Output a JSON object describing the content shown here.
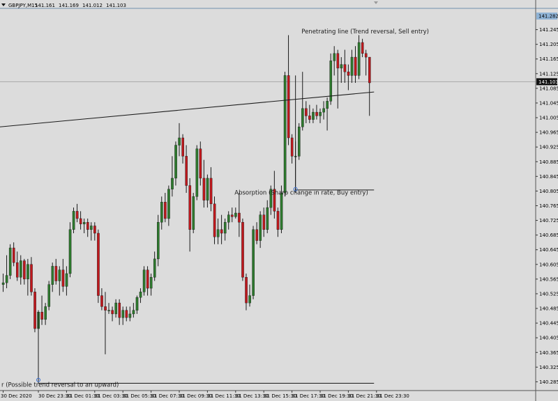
{
  "symbol_header": {
    "symbol": "GBPJPY,M15",
    "ohlc": [
      "141.161",
      "141.169",
      "141.012",
      "141.103"
    ],
    "menu_arrow_icon": "triangle-down-icon"
  },
  "colors": {
    "background": "#dcdcdc",
    "bull": "#2d7a2d",
    "bear": "#c0181d",
    "wick": "#1a1a1a",
    "line": "#1a1a1a",
    "grid_line": "#a8a8a8",
    "current_price_label_bg": "#111111",
    "top_price_label_bg": "#8fb3d6"
  },
  "chart_data": {
    "type": "candlestick",
    "y_axis_ticks": [
      "141.245",
      "141.205",
      "141.165",
      "141.125",
      "141.085",
      "141.045",
      "141.005",
      "140.965",
      "140.925",
      "140.885",
      "140.845",
      "140.805",
      "140.765",
      "140.725",
      "140.685",
      "140.645",
      "140.605",
      "140.565",
      "140.525",
      "140.485",
      "140.445",
      "140.405",
      "140.365",
      "140.325",
      "140.285"
    ],
    "ylim": [
      140.263,
      141.303
    ],
    "x_axis_ticks": [
      "30 Dec 2020",
      "30 Dec 23:30",
      "31 Dec 01:30",
      "31 Dec 03:30",
      "31 Dec 05:30",
      "31 Dec 07:30",
      "31 Dec 09:30",
      "31 Dec 11:30",
      "31 Dec 13:30",
      "31 Dec 15:30",
      "31 Dec 17:30",
      "31 Dec 19:30",
      "31 Dec 21:30",
      "31 Dec 23:30"
    ],
    "x_tick_index": [
      0,
      10,
      18,
      26,
      34,
      42,
      50,
      58,
      66,
      74,
      82,
      90,
      98,
      106
    ],
    "current_price": "141.103",
    "top_price_label": "141.282",
    "candles": [
      [
        140.55,
        140.58,
        140.53,
        140.555
      ],
      [
        140.555,
        140.63,
        140.54,
        140.575
      ],
      [
        140.575,
        140.66,
        140.565,
        140.65
      ],
      [
        140.65,
        140.665,
        140.6,
        140.61
      ],
      [
        140.61,
        140.64,
        140.56,
        140.57
      ],
      [
        140.57,
        140.63,
        140.55,
        140.615
      ],
      [
        140.615,
        140.62,
        140.55,
        140.565
      ],
      [
        140.565,
        140.62,
        140.52,
        140.605
      ],
      [
        140.605,
        140.625,
        140.52,
        140.53
      ],
      [
        140.53,
        140.54,
        140.42,
        140.43
      ],
      [
        140.43,
        140.48,
        140.28,
        140.475
      ],
      [
        140.475,
        140.52,
        140.44,
        140.455
      ],
      [
        140.455,
        140.5,
        140.44,
        140.49
      ],
      [
        140.49,
        140.56,
        140.48,
        140.55
      ],
      [
        140.55,
        140.61,
        140.53,
        140.6
      ],
      [
        140.6,
        140.62,
        140.55,
        140.56
      ],
      [
        140.56,
        140.6,
        140.52,
        140.59
      ],
      [
        140.59,
        140.62,
        140.53,
        140.545
      ],
      [
        140.545,
        140.6,
        140.52,
        140.58
      ],
      [
        140.58,
        140.72,
        140.57,
        140.7
      ],
      [
        140.7,
        140.76,
        140.69,
        140.75
      ],
      [
        140.75,
        140.77,
        140.72,
        140.73
      ],
      [
        140.73,
        140.75,
        140.7,
        140.715
      ],
      [
        140.715,
        140.73,
        140.69,
        140.72
      ],
      [
        140.72,
        140.73,
        140.68,
        140.7
      ],
      [
        140.7,
        140.72,
        140.67,
        140.71
      ],
      [
        140.71,
        140.72,
        140.67,
        140.69
      ],
      [
        140.69,
        140.7,
        140.5,
        140.52
      ],
      [
        140.52,
        140.54,
        140.48,
        140.49
      ],
      [
        140.49,
        140.53,
        140.36,
        140.48
      ],
      [
        140.48,
        140.5,
        140.47,
        140.48
      ],
      [
        140.48,
        140.49,
        140.45,
        140.47
      ],
      [
        140.47,
        140.51,
        140.46,
        140.5
      ],
      [
        140.5,
        140.51,
        140.44,
        140.46
      ],
      [
        140.46,
        140.49,
        140.44,
        140.48
      ],
      [
        140.48,
        140.49,
        140.45,
        140.46
      ],
      [
        140.46,
        140.49,
        140.45,
        140.47
      ],
      [
        140.47,
        140.5,
        140.46,
        140.48
      ],
      [
        140.48,
        140.52,
        140.47,
        140.515
      ],
      [
        140.515,
        140.54,
        140.5,
        140.53
      ],
      [
        140.53,
        140.6,
        140.52,
        140.59
      ],
      [
        140.59,
        140.6,
        140.52,
        140.54
      ],
      [
        140.54,
        140.58,
        140.52,
        140.57
      ],
      [
        140.57,
        140.64,
        140.56,
        140.62
      ],
      [
        140.62,
        140.74,
        140.6,
        140.72
      ],
      [
        140.72,
        140.79,
        140.7,
        140.775
      ],
      [
        140.775,
        140.8,
        140.72,
        140.73
      ],
      [
        140.73,
        140.82,
        140.71,
        140.81
      ],
      [
        140.81,
        140.9,
        140.79,
        140.84
      ],
      [
        140.84,
        140.94,
        140.82,
        140.93
      ],
      [
        140.93,
        140.99,
        140.9,
        140.95
      ],
      [
        140.95,
        140.96,
        140.88,
        140.9
      ],
      [
        140.9,
        140.93,
        140.8,
        140.82
      ],
      [
        140.82,
        140.84,
        140.64,
        140.7
      ],
      [
        140.7,
        140.8,
        140.69,
        140.79
      ],
      [
        140.79,
        140.93,
        140.78,
        140.92
      ],
      [
        140.92,
        140.94,
        140.82,
        140.84
      ],
      [
        140.84,
        140.89,
        140.76,
        140.78
      ],
      [
        140.78,
        140.85,
        140.76,
        140.84
      ],
      [
        140.84,
        140.87,
        140.75,
        140.77
      ],
      [
        140.77,
        140.79,
        140.66,
        140.68
      ],
      [
        140.68,
        140.73,
        140.66,
        140.7
      ],
      [
        140.7,
        140.74,
        140.66,
        140.69
      ],
      [
        140.69,
        140.73,
        140.67,
        140.72
      ],
      [
        140.72,
        140.75,
        140.7,
        140.74
      ],
      [
        140.74,
        140.76,
        140.72,
        140.735
      ],
      [
        140.735,
        140.76,
        140.73,
        140.745
      ],
      [
        140.745,
        140.8,
        140.68,
        140.72
      ],
      [
        140.72,
        140.73,
        140.56,
        140.57
      ],
      [
        140.57,
        140.58,
        140.48,
        140.5
      ],
      [
        140.5,
        140.55,
        140.49,
        140.52
      ],
      [
        140.52,
        140.71,
        140.51,
        140.7
      ],
      [
        140.7,
        140.72,
        140.66,
        140.67
      ],
      [
        140.67,
        140.75,
        140.65,
        140.74
      ],
      [
        140.74,
        140.76,
        140.68,
        140.7
      ],
      [
        140.7,
        140.78,
        140.69,
        140.76
      ],
      [
        140.76,
        140.82,
        140.74,
        140.81
      ],
      [
        140.81,
        140.86,
        140.73,
        140.75
      ],
      [
        140.75,
        140.76,
        140.68,
        140.7
      ],
      [
        140.7,
        140.82,
        140.69,
        140.8
      ],
      [
        140.8,
        141.13,
        140.79,
        141.12
      ],
      [
        141.12,
        141.23,
        140.93,
        140.95
      ],
      [
        140.95,
        140.96,
        140.88,
        140.9
      ],
      [
        140.9,
        140.94,
        140.8,
        140.9
      ],
      [
        140.9,
        140.99,
        140.89,
        140.98
      ],
      [
        140.98,
        141.13,
        140.97,
        141.03
      ],
      [
        141.03,
        141.05,
        140.99,
        141.01
      ],
      [
        141.01,
        141.04,
        140.99,
        141.0
      ],
      [
        141.0,
        141.03,
        140.99,
        141.02
      ],
      [
        141.02,
        141.04,
        141.0,
        141.01
      ],
      [
        141.01,
        141.03,
        140.99,
        141.02
      ],
      [
        141.02,
        141.05,
        141.0,
        141.03
      ],
      [
        141.03,
        141.06,
        140.97,
        141.05
      ],
      [
        141.05,
        141.18,
        141.04,
        141.16
      ],
      [
        141.16,
        141.2,
        141.12,
        141.18
      ],
      [
        141.18,
        141.19,
        141.03,
        141.14
      ],
      [
        141.14,
        141.17,
        141.1,
        141.15
      ],
      [
        141.15,
        141.19,
        141.1,
        141.13
      ],
      [
        141.13,
        141.15,
        141.08,
        141.12
      ],
      [
        141.12,
        141.19,
        141.1,
        141.17
      ],
      [
        141.17,
        141.2,
        141.1,
        141.12
      ],
      [
        141.12,
        141.23,
        141.11,
        141.21
      ],
      [
        141.21,
        141.22,
        141.17,
        141.18
      ],
      [
        141.18,
        141.19,
        141.12,
        141.17
      ],
      [
        141.17,
        141.17,
        141.01,
        141.1
      ]
    ],
    "trendline": {
      "from_index": -6,
      "from_price": 140.975,
      "to_index": 105,
      "to_price": 141.075
    },
    "annotations": [
      {
        "label": "Penetrating line (Trend reversal, Sell entry)",
        "index": 85,
        "price": 141.235
      },
      {
        "label": "Absorption (Sharp change in rate, Buy entry)",
        "index": 66,
        "price": 140.795
      },
      {
        "label": "r (Possible trend reversal to an upward)",
        "index": -6,
        "price": 140.272
      }
    ],
    "horizontal_segments": [
      {
        "from_index": 83,
        "to_index": 105,
        "price": 140.808
      },
      {
        "from_index": 10,
        "to_index": 105,
        "price": 140.281
      }
    ],
    "vertical_markers": [
      {
        "index": 83,
        "from_price": 140.808,
        "to_price": 141.12
      }
    ]
  }
}
